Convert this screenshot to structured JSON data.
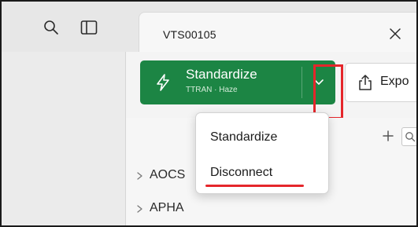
{
  "tab": {
    "title": "VTS00105"
  },
  "toolbar": {
    "primary_label": "Standardize",
    "primary_sub": "TTRAN · Haze",
    "export_label": "Expo"
  },
  "dropdown": {
    "items": [
      {
        "label": "Standardize"
      },
      {
        "label": "Disconnect"
      }
    ]
  },
  "tree": {
    "items": [
      {
        "label": "AOCS"
      },
      {
        "label": "APHA"
      }
    ]
  },
  "icons": {
    "search": "search-icon",
    "sidebar_toggle": "sidebar-toggle-icon",
    "close": "close-icon",
    "bolt": "lightning-icon",
    "chevron": "chevron-down-icon",
    "export": "share-export-icon",
    "add": "plus-icon"
  },
  "colors": {
    "primary": "#1c8544",
    "annotation": "#e5262b"
  }
}
